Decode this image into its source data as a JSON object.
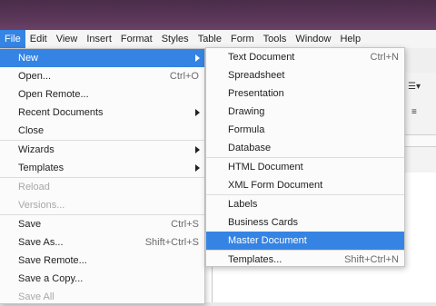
{
  "menubar": [
    {
      "label": "File",
      "active": true
    },
    {
      "label": "Edit"
    },
    {
      "label": "View"
    },
    {
      "label": "Insert"
    },
    {
      "label": "Format"
    },
    {
      "label": "Styles"
    },
    {
      "label": "Table"
    },
    {
      "label": "Form"
    },
    {
      "label": "Tools"
    },
    {
      "label": "Window"
    },
    {
      "label": "Help"
    }
  ],
  "file_menu": [
    {
      "label": "New",
      "shortcut": "",
      "submenu": true,
      "highlight": true
    },
    {
      "label": "Open...",
      "shortcut": "Ctrl+O"
    },
    {
      "label": "Open Remote...",
      "shortcut": ""
    },
    {
      "label": "Recent Documents",
      "shortcut": "",
      "submenu": true
    },
    {
      "label": "Close",
      "shortcut": ""
    },
    {
      "label": "Wizards",
      "shortcut": "",
      "submenu": true,
      "sep": true
    },
    {
      "label": "Templates",
      "shortcut": "",
      "submenu": true
    },
    {
      "label": "Reload",
      "shortcut": "",
      "disabled": true,
      "sep": true
    },
    {
      "label": "Versions...",
      "shortcut": "",
      "disabled": true
    },
    {
      "label": "Save",
      "shortcut": "Ctrl+S",
      "sep": true
    },
    {
      "label": "Save As...",
      "shortcut": "Shift+Ctrl+S"
    },
    {
      "label": "Save Remote...",
      "shortcut": ""
    },
    {
      "label": "Save a Copy...",
      "shortcut": ""
    },
    {
      "label": "Save All",
      "shortcut": "",
      "disabled": true
    }
  ],
  "new_submenu": [
    {
      "label": "Text Document",
      "shortcut": "Ctrl+N"
    },
    {
      "label": "Spreadsheet",
      "shortcut": ""
    },
    {
      "label": "Presentation",
      "shortcut": ""
    },
    {
      "label": "Drawing",
      "shortcut": ""
    },
    {
      "label": "Formula",
      "shortcut": ""
    },
    {
      "label": "Database",
      "shortcut": ""
    },
    {
      "label": "HTML Document",
      "shortcut": "",
      "sep": true
    },
    {
      "label": "XML Form Document",
      "shortcut": ""
    },
    {
      "label": "Labels",
      "shortcut": "",
      "sep": true
    },
    {
      "label": "Business Cards",
      "shortcut": ""
    },
    {
      "label": "Master Document",
      "shortcut": "",
      "highlight": true
    },
    {
      "label": "Templates...",
      "shortcut": "Shift+Ctrl+N",
      "sep": true
    }
  ],
  "colors": {
    "accent": "#3584e4",
    "titlebar": "#5a3658"
  }
}
